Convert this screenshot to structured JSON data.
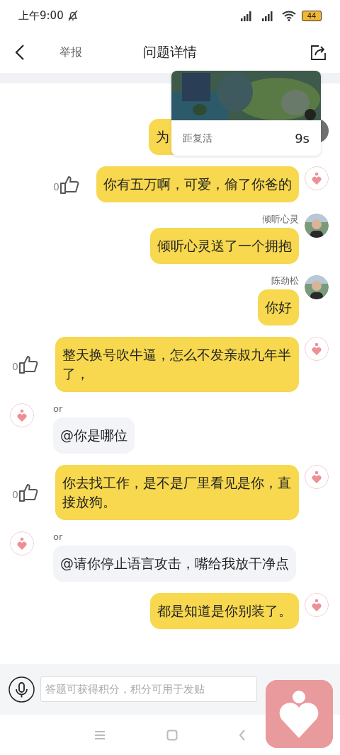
{
  "status_bar": {
    "time": "上午9:00",
    "battery": "44"
  },
  "header": {
    "action": "举报",
    "title": "问题详情"
  },
  "pip": {
    "label": "距复活",
    "countdown": "9s"
  },
  "messages": [
    {
      "kind": "outgoing",
      "text": "为",
      "avatar": {
        "kind": "gray"
      }
    },
    {
      "kind": "outgoing",
      "text": "你有五万啊，可爱，偷了你爸的",
      "likes": "0",
      "avatar": {
        "kind": "heart"
      }
    },
    {
      "kind": "outgoing",
      "name": "倾听心灵",
      "text": "倾听心灵送了一个拥抱"
    },
    {
      "kind": "outgoing",
      "name": "陈劲松",
      "text": "你好"
    },
    {
      "kind": "outgoing",
      "text": "整天换号吹牛逼，怎么不发亲叔九年半了，",
      "likes": "0",
      "avatar": {
        "kind": "heart"
      }
    },
    {
      "kind": "incoming",
      "name": "or",
      "text": "@你是哪位",
      "avatar": {
        "kind": "heart"
      }
    },
    {
      "kind": "outgoing",
      "text": "你去找工作，是不是厂里看见是你，直接放狗。",
      "likes": "0",
      "avatar": {
        "kind": "heart"
      }
    },
    {
      "kind": "incoming",
      "name": "or",
      "text": "@请你停止语言攻击，嘴给我放干净点",
      "avatar": {
        "kind": "heart"
      }
    },
    {
      "kind": "outgoing",
      "text": "都是知道是你别装了。",
      "avatar": {
        "kind": "heart"
      }
    }
  ],
  "input": {
    "placeholder": "答题可获得积分，积分可用于发贴"
  }
}
